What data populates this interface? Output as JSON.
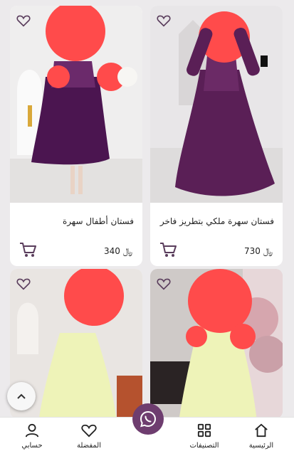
{
  "products": [
    {
      "title": "فستان سهرة ملكي بتطريز فاخر",
      "price": "730"
    },
    {
      "title": "فستان أطفال سهرة",
      "price": "340"
    },
    {
      "title": "",
      "price": ""
    },
    {
      "title": "",
      "price": ""
    }
  ],
  "currency_symbol": "﷼",
  "nav": {
    "home": "الرئيسية",
    "categories": "التصنيفات",
    "favorites": "المفضلة",
    "account": "حسابي"
  },
  "colors": {
    "accent": "#6e3d6f",
    "dress_purple": "#5a1f56",
    "dress_yellow": "#eef3b8",
    "redaction": "#ff4b4b"
  }
}
